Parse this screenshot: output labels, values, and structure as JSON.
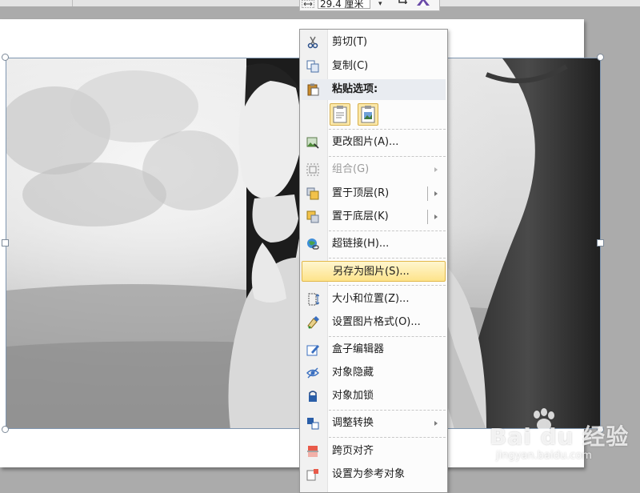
{
  "toolbar": {
    "size_value": "29.4 厘米"
  },
  "context_menu": {
    "items": [
      {
        "id": "cut",
        "label": "剪切(T)",
        "icon": "scissors-icon"
      },
      {
        "id": "copy",
        "label": "复制(C)",
        "icon": "copy-icon"
      },
      {
        "id": "paste-options",
        "label": "粘贴选项:",
        "icon": "paste-icon"
      },
      {
        "id": "change-picture",
        "label": "更改图片(A)...",
        "icon": "change-picture-icon"
      },
      {
        "id": "group",
        "label": "组合(G)",
        "icon": "group-icon",
        "disabled": true
      },
      {
        "id": "bring-to-front",
        "label": "置于顶层(R)",
        "icon": "bring-front-icon"
      },
      {
        "id": "send-to-back",
        "label": "置于底层(K)",
        "icon": "send-back-icon"
      },
      {
        "id": "hyperlink",
        "label": "超链接(H)...",
        "icon": "hyperlink-icon"
      },
      {
        "id": "save-as-picture",
        "label": "另存为图片(S)...",
        "highlighted": true
      },
      {
        "id": "size-position",
        "label": "大小和位置(Z)...",
        "icon": "size-position-icon"
      },
      {
        "id": "format-picture",
        "label": "设置图片格式(O)...",
        "icon": "format-picture-icon"
      },
      {
        "id": "box-editor",
        "label": "盒子编辑器",
        "icon": "box-editor-icon"
      },
      {
        "id": "object-hide",
        "label": "对象隐藏",
        "icon": "eye-hidden-icon"
      },
      {
        "id": "object-lock",
        "label": "对象加锁",
        "icon": "lock-icon"
      },
      {
        "id": "adjust-convert",
        "label": "调整转换",
        "icon": "convert-icon"
      },
      {
        "id": "cross-page-align",
        "label": "跨页对齐",
        "icon": "align-icon"
      },
      {
        "id": "set-reference",
        "label": "设置为参考对象",
        "icon": "reference-icon"
      }
    ]
  },
  "watermark": {
    "brand": "Bai  du 经验",
    "url": "jingyan.baidu.com"
  },
  "colors": {
    "menu_highlight": "#fde38a",
    "selection_border": "#7f96b0"
  }
}
